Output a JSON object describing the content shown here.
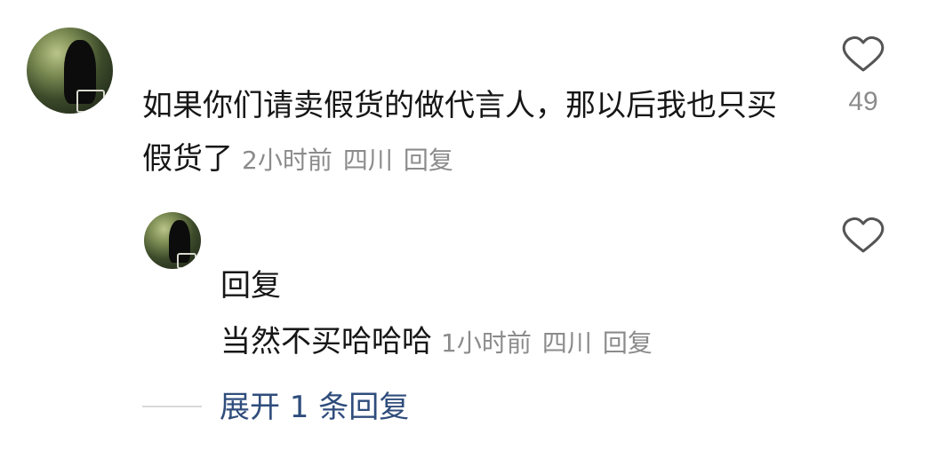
{
  "comment": {
    "avatar": "user-avatar",
    "text": "如果你们请卖假货的做代言人，那以后我也只买假货了",
    "time": "2小时前",
    "location": "四川",
    "reply_label": "回复",
    "like_count": "49"
  },
  "reply": {
    "avatar": "user-avatar",
    "name": "回复",
    "text": "当然不买哈哈哈",
    "time": "1小时前",
    "location": "四川",
    "reply_label": "回复"
  },
  "expand": {
    "label": "展开 1 条回复"
  },
  "colors": {
    "text": "#161616",
    "meta": "#8b8b8b",
    "link": "#2f4d7c",
    "divider": "#d9d9d9"
  },
  "icons": {
    "like": "heart-outline-icon"
  }
}
